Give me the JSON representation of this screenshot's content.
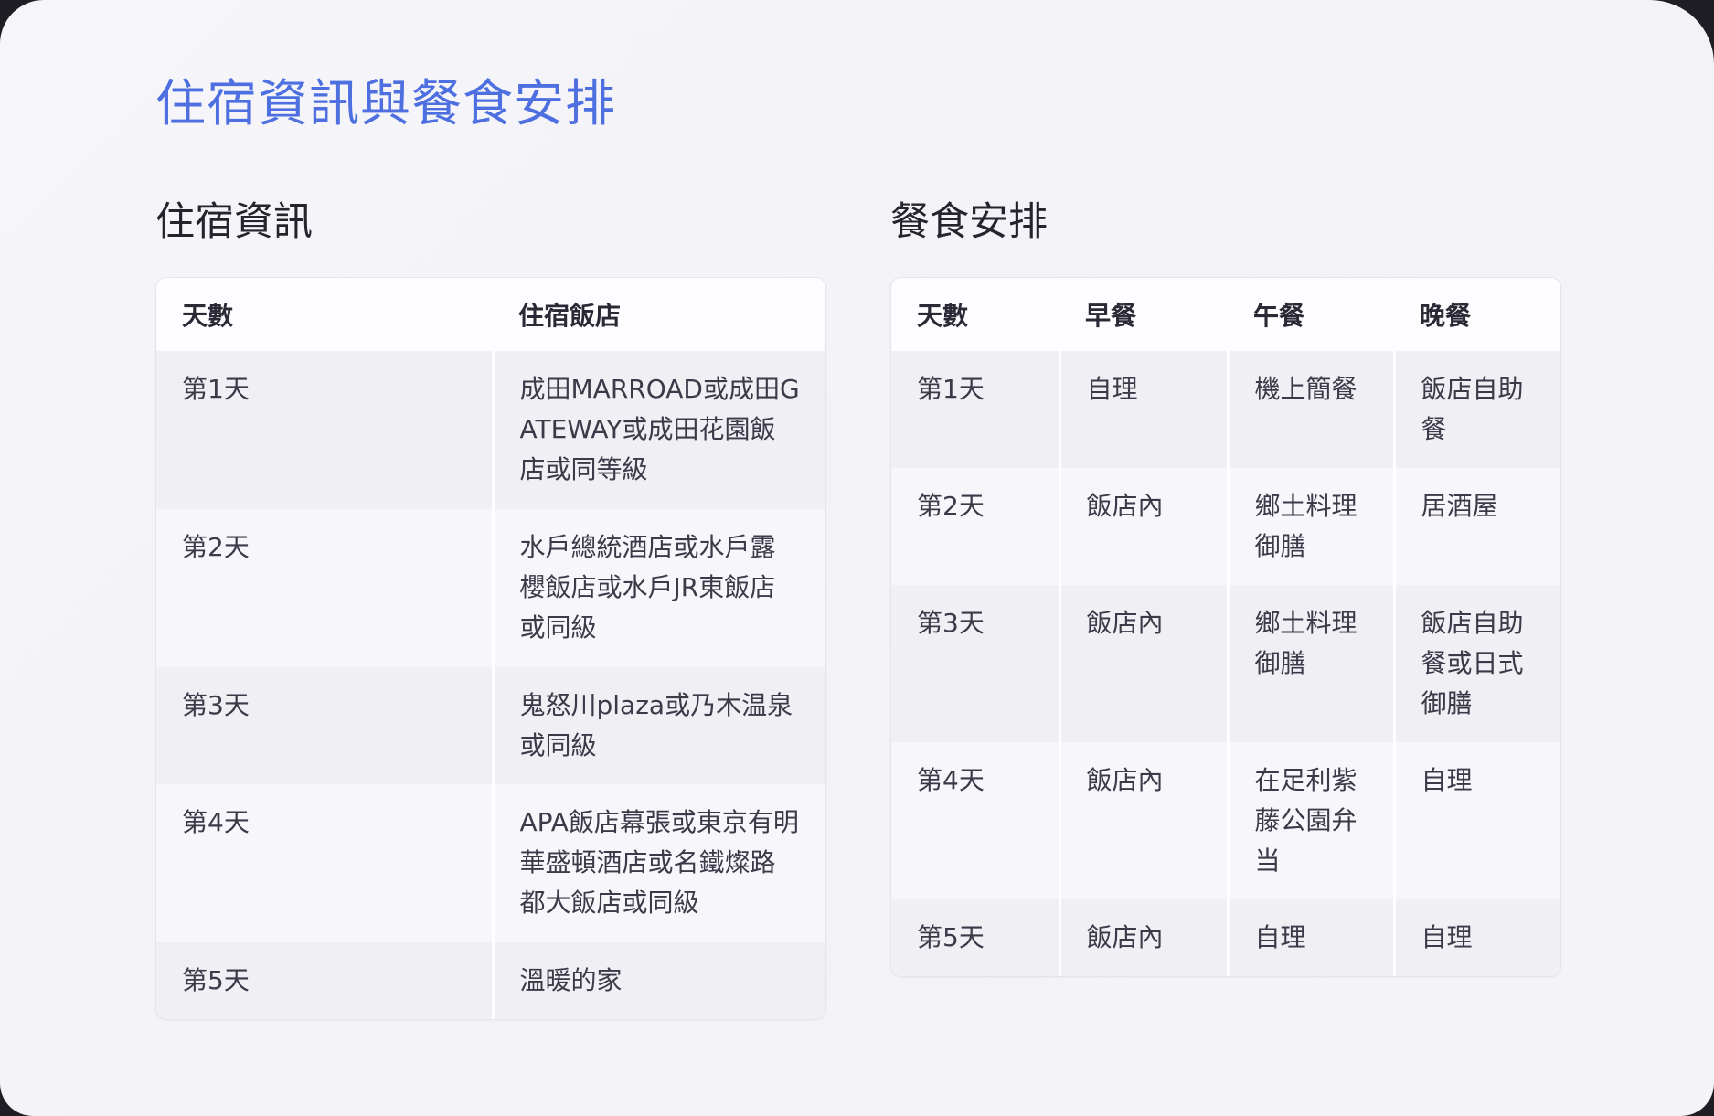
{
  "page_title": "住宿資訊與餐食安排",
  "accommodation": {
    "title": "住宿資訊",
    "headers": [
      "天數",
      "住宿飯店"
    ],
    "rows": [
      [
        "第1天",
        "成田MARROAD或成田GATEWAY或成田花園飯店或同等級"
      ],
      [
        "第2天",
        "水戶總統酒店或水戶露櫻飯店或水戶JR東飯店或同級"
      ],
      [
        "第3天",
        "鬼怒川plaza或乃木温泉或同級"
      ],
      [
        "第4天",
        "APA飯店幕張或東京有明華盛頓酒店或名鐵燦路都大飯店或同級"
      ],
      [
        "第5天",
        "溫暖的家"
      ]
    ]
  },
  "meals": {
    "title": "餐食安排",
    "headers": [
      "天數",
      "早餐",
      "午餐",
      "晚餐"
    ],
    "rows": [
      [
        "第1天",
        "自理",
        "機上簡餐",
        "飯店自助餐"
      ],
      [
        "第2天",
        "飯店內",
        "鄉土料理御膳",
        "居酒屋"
      ],
      [
        "第3天",
        "飯店內",
        "鄉土料理御膳",
        "飯店自助餐或日式御膳"
      ],
      [
        "第4天",
        "飯店內",
        "在足利紫藤公園弁当",
        "自理"
      ],
      [
        "第5天",
        "飯店內",
        "自理",
        "自理"
      ]
    ]
  }
}
